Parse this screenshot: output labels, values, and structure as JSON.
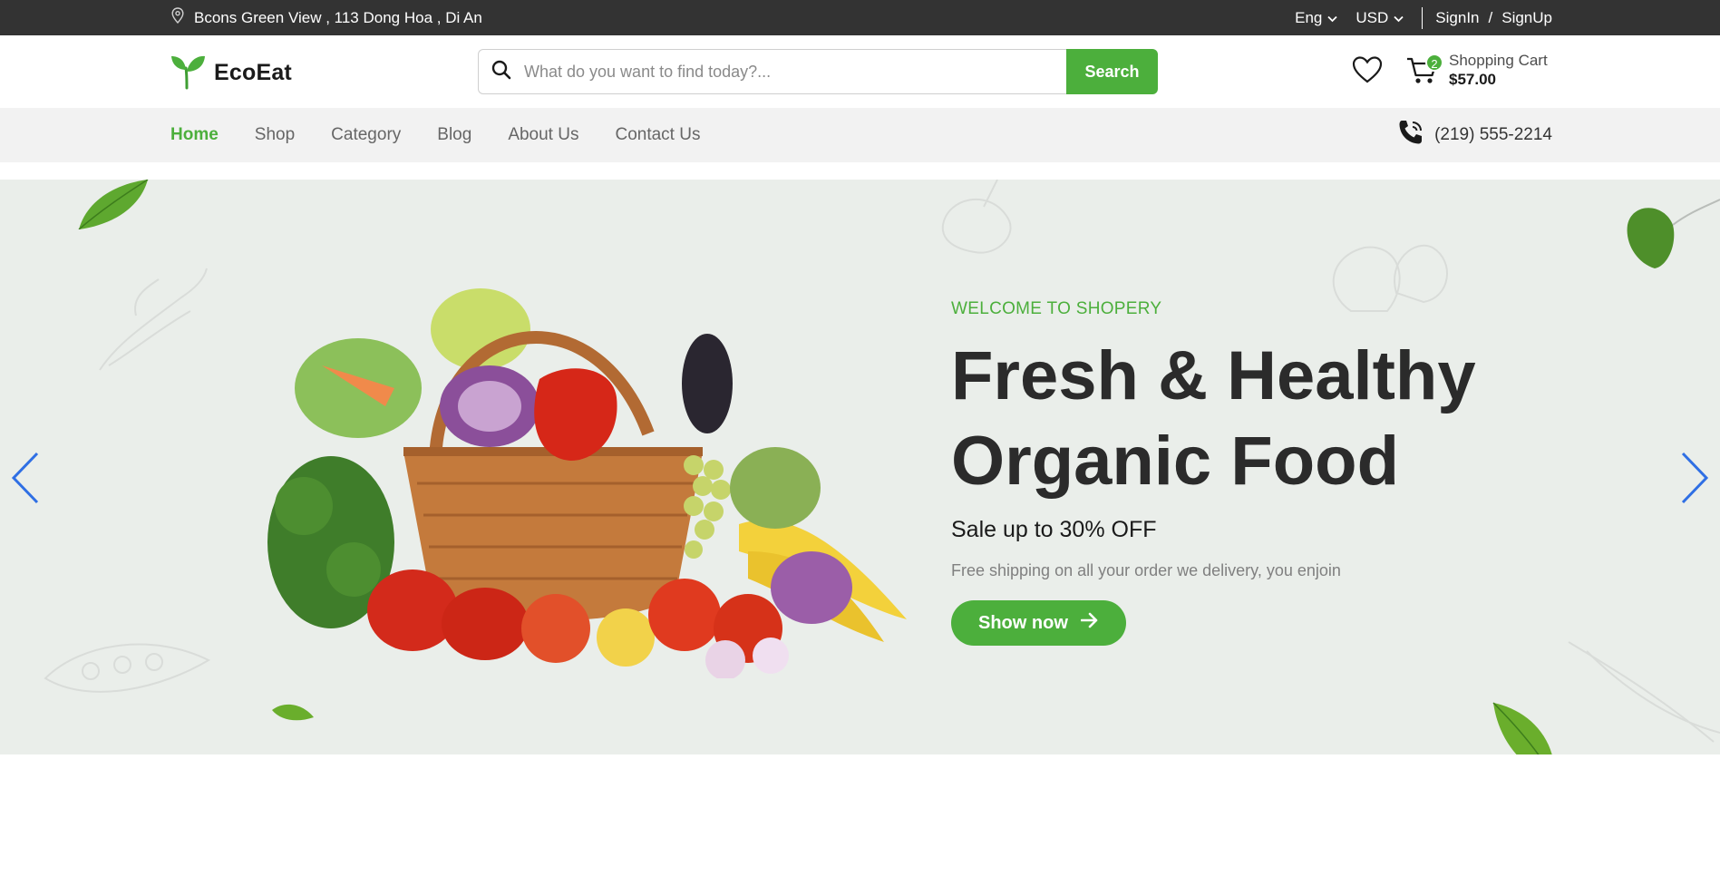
{
  "topbar": {
    "location": "Bcons Green View , 113 Dong Hoa , Di An",
    "language": "Eng",
    "currency": "USD",
    "signin": "SignIn",
    "separator": "/",
    "signup": "SignUp"
  },
  "header": {
    "brand": "EcoEat",
    "search": {
      "placeholder": "What do you want to find today?...",
      "value": "",
      "button_label": "Search"
    },
    "cart": {
      "count": "2",
      "label": "Shopping Cart",
      "amount": "$57.00"
    }
  },
  "nav": {
    "items": [
      {
        "label": "Home",
        "active": true
      },
      {
        "label": "Shop",
        "active": false
      },
      {
        "label": "Category",
        "active": false
      },
      {
        "label": "Blog",
        "active": false
      },
      {
        "label": "About Us",
        "active": false
      },
      {
        "label": "Contact Us",
        "active": false
      }
    ],
    "phone": "(219) 555-2214"
  },
  "hero": {
    "eyebrow": "WELCOME TO SHOPERY",
    "title": "Fresh & Healthy Organic Food",
    "subtitle": "Sale up to 30% OFF",
    "description": "Free shipping on all your order we delivery, you enjoin",
    "cta_label": "Show now"
  },
  "icons": {
    "location": "map-pin-icon",
    "chevron": "chevron-down-icon",
    "search": "search-icon",
    "wishlist": "heart-icon",
    "cart": "cart-icon",
    "phone": "phone-icon",
    "prev": "chevron-left-icon",
    "next": "chevron-right-icon",
    "cta": "arrow-right-icon"
  },
  "colors": {
    "brand_green": "#4caf3c",
    "topbar_bg": "#333333",
    "nav_bg": "#f2f2f2",
    "hero_bg": "#eaeeea",
    "arrow_blue": "#2f6fe4"
  }
}
